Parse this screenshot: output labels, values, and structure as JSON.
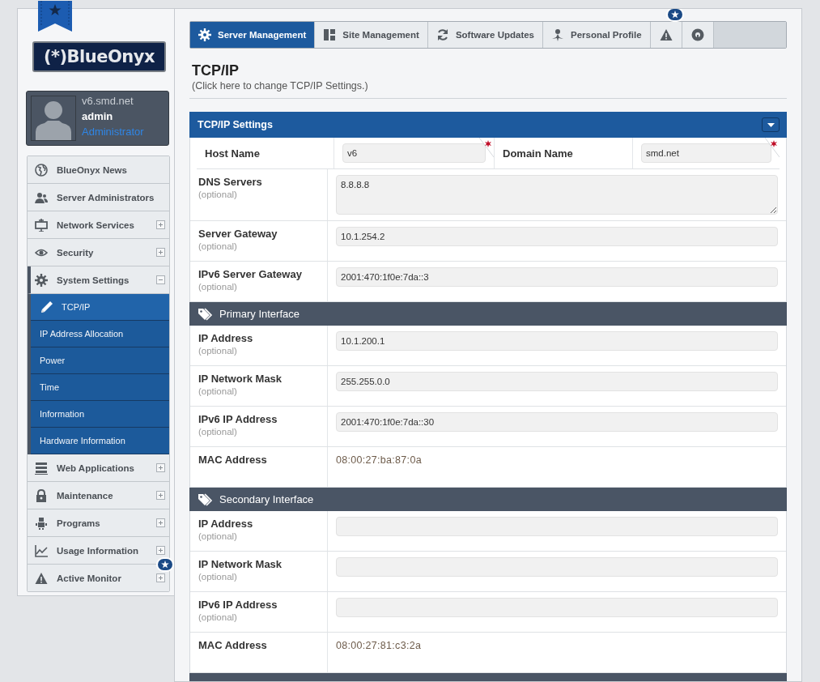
{
  "logo": {
    "text": "(*)BlueOnyx"
  },
  "user": {
    "host": "v6.smd.net",
    "name": "admin",
    "role": "Administrator"
  },
  "menu": [
    {
      "label": "BlueOnyx News",
      "kind": "link"
    },
    {
      "label": "Server Administrators",
      "kind": "link"
    },
    {
      "label": "Network Services",
      "kind": "group",
      "expanded": false
    },
    {
      "label": "Security",
      "kind": "group",
      "expanded": false
    },
    {
      "label": "System Settings",
      "kind": "group",
      "expanded": true,
      "children": [
        {
          "label": "TCP/IP",
          "selected": true
        },
        {
          "label": "IP Address Allocation",
          "selected": false
        },
        {
          "label": "Power",
          "selected": false
        },
        {
          "label": "Time",
          "selected": false
        },
        {
          "label": "Information",
          "selected": false
        },
        {
          "label": "Hardware Information",
          "selected": false
        }
      ]
    },
    {
      "label": "Web Applications",
      "kind": "group",
      "expanded": false
    },
    {
      "label": "Maintenance",
      "kind": "group",
      "expanded": false
    },
    {
      "label": "Programs",
      "kind": "group",
      "expanded": false
    },
    {
      "label": "Usage Information",
      "kind": "group",
      "expanded": false
    },
    {
      "label": "Active Monitor",
      "kind": "group",
      "expanded": false,
      "badge": true
    }
  ],
  "tabs": [
    {
      "label": "Server Management",
      "selected": true
    },
    {
      "label": "Site Management",
      "selected": false
    },
    {
      "label": "Software Updates",
      "selected": false
    },
    {
      "label": "Personal Profile",
      "selected": false
    },
    {
      "kind": "icon",
      "selected": false,
      "badge": true
    },
    {
      "kind": "icon",
      "selected": false
    }
  ],
  "page": {
    "title": "TCP/IP",
    "subtitle": "(Click here to change TCP/IP Settings.)"
  },
  "form": {
    "title": "TCP/IP Settings",
    "rows": [
      {
        "kind": "pair",
        "fields": [
          {
            "label": "Host Name",
            "value": "v6",
            "required": true
          },
          {
            "label": "Domain Name",
            "value": "smd.net",
            "required": true
          }
        ]
      },
      {
        "kind": "textarea",
        "label": "DNS Servers",
        "hint": "(optional)",
        "value": "8.8.8.8"
      },
      {
        "kind": "input",
        "label": "Server Gateway",
        "hint": "(optional)",
        "value": "10.1.254.2"
      },
      {
        "kind": "input",
        "label": "IPv6 Server Gateway",
        "hint": "(optional)",
        "value": "2001:470:1f0e:7da::3"
      },
      {
        "kind": "section",
        "title": "Primary Interface"
      },
      {
        "kind": "input",
        "label": "IP Address",
        "hint": "(optional)",
        "value": "10.1.200.1"
      },
      {
        "kind": "input",
        "label": "IP Network Mask",
        "hint": "(optional)",
        "value": "255.255.0.0"
      },
      {
        "kind": "input",
        "label": "IPv6 IP Address",
        "hint": "(optional)",
        "value": "2001:470:1f0e:7da::30"
      },
      {
        "kind": "static",
        "label": "MAC Address",
        "value": "08:00:27:ba:87:0a"
      },
      {
        "kind": "section",
        "title": "Secondary Interface"
      },
      {
        "kind": "input",
        "label": "IP Address",
        "hint": "(optional)"
      },
      {
        "kind": "input",
        "label": "IP Network Mask",
        "hint": "(optional)"
      },
      {
        "kind": "input",
        "label": "IPv6 IP Address",
        "hint": "(optional)"
      },
      {
        "kind": "static",
        "label": "MAC Address",
        "value": "08:00:27:81:c3:2a"
      },
      {
        "kind": "section"
      }
    ]
  }
}
